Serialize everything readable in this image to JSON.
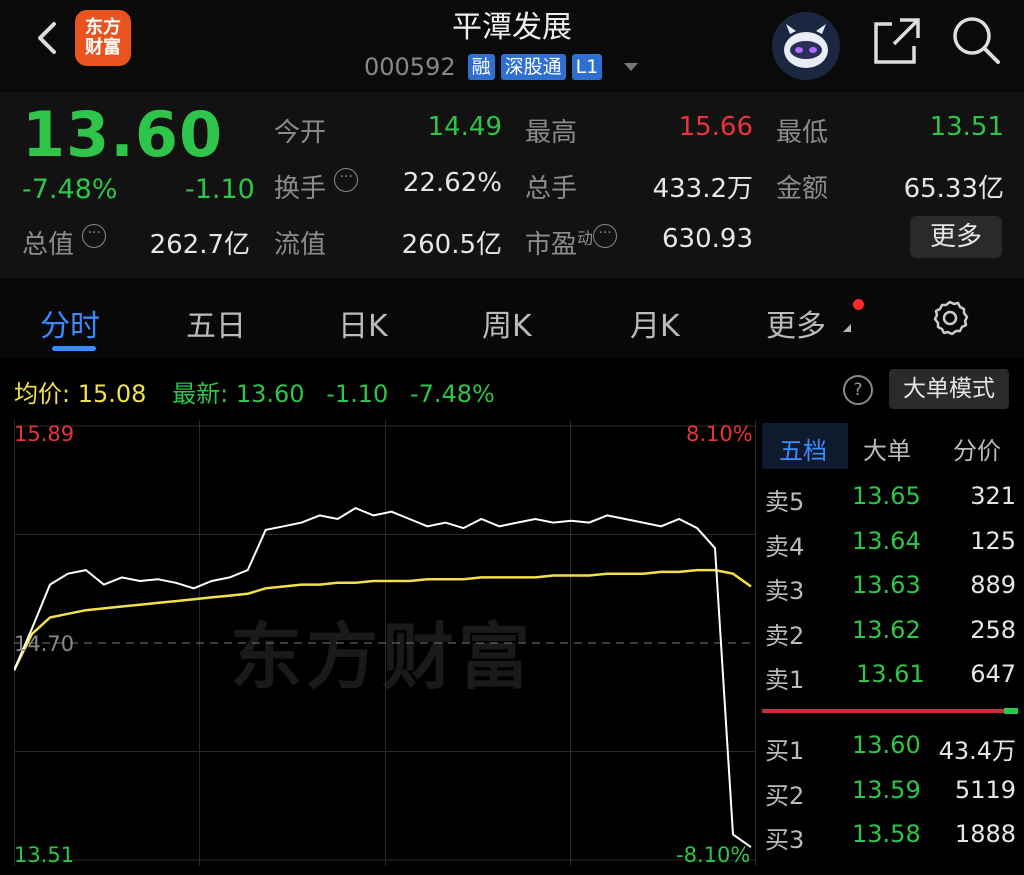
{
  "header": {
    "title": "平潭发展",
    "code": "000592",
    "tags": [
      "融",
      "深股通",
      "L1"
    ],
    "logo_text": [
      "东方",
      "财富"
    ]
  },
  "quote": {
    "price": "13.60",
    "change_pct": "-7.48%",
    "change": "-1.10",
    "fields": {
      "open_label": "今开",
      "open": "14.49",
      "high_label": "最高",
      "high": "15.66",
      "low_label": "最低",
      "low": "13.51",
      "turnover_label": "换手",
      "turnover": "22.62%",
      "volume_label": "总手",
      "volume": "433.2万",
      "amount_label": "金额",
      "amount": "65.33亿",
      "mktcap_label": "总值",
      "mktcap": "262.7亿",
      "float_label": "流值",
      "float": "260.5亿",
      "pe_label": "市盈",
      "pe_sup": "动",
      "pe": "630.93"
    },
    "more_label": "更多"
  },
  "tabs": [
    "分时",
    "五日",
    "日K",
    "周K",
    "月K",
    "更多"
  ],
  "chart_header": {
    "avg_label": "均价:",
    "avg": "15.08",
    "latest_label": "最新:",
    "latest": "13.60",
    "change": "-1.10",
    "change_pct": "-7.48%",
    "help": "?",
    "big_order_label": "大单模式"
  },
  "chart_labels": {
    "top_left": "15.89",
    "mid_left": "14.70",
    "bottom_left": "13.51",
    "top_right": "8.10%",
    "bottom_right": "-8.10%",
    "watermark": "东方财富"
  },
  "chart_data": {
    "type": "line",
    "ylim": [
      13.51,
      15.89
    ],
    "prev_close": 14.7,
    "series": [
      {
        "values": [
          14.55,
          14.78,
          15.02,
          15.08,
          15.1,
          15.02,
          15.06,
          15.04,
          15.05,
          15.03,
          15.0,
          15.04,
          15.06,
          15.1,
          15.32,
          15.34,
          15.36,
          15.4,
          15.38,
          15.44,
          15.4,
          15.42,
          15.38,
          15.34,
          15.36,
          15.33,
          15.38,
          15.34,
          15.36,
          15.38,
          15.36,
          15.37,
          15.36,
          15.4,
          15.38,
          15.36,
          15.34,
          15.38,
          15.33,
          15.22,
          13.65,
          13.58
        ]
      },
      {
        "values": [
          14.55,
          14.75,
          14.84,
          14.86,
          14.88,
          14.89,
          14.9,
          14.91,
          14.92,
          14.93,
          14.94,
          14.95,
          14.96,
          14.97,
          15.0,
          15.01,
          15.02,
          15.02,
          15.03,
          15.03,
          15.04,
          15.04,
          15.04,
          15.05,
          15.05,
          15.05,
          15.06,
          15.06,
          15.06,
          15.06,
          15.07,
          15.07,
          15.07,
          15.08,
          15.08,
          15.08,
          15.09,
          15.09,
          15.1,
          15.1,
          15.08,
          15.01
        ]
      }
    ]
  },
  "order_book": {
    "tabs": [
      "五档",
      "大单",
      "分价"
    ],
    "asks": [
      {
        "label": "卖5",
        "price": "13.65",
        "vol": "321"
      },
      {
        "label": "卖4",
        "price": "13.64",
        "vol": "125"
      },
      {
        "label": "卖3",
        "price": "13.63",
        "vol": "889"
      },
      {
        "label": "卖2",
        "price": "13.62",
        "vol": "258"
      },
      {
        "label": "卖1",
        "price": "13.61",
        "vol": "647"
      }
    ],
    "bids": [
      {
        "label": "买1",
        "price": "13.60",
        "vol": "43.4万"
      },
      {
        "label": "买2",
        "price": "13.59",
        "vol": "5119"
      },
      {
        "label": "买3",
        "price": "13.58",
        "vol": "1888"
      }
    ]
  },
  "colors": {
    "up": "#e8343a",
    "down": "#2fc44a",
    "accent": "#3a8dff",
    "price_line": "#ffffff",
    "avg_line": "#f2e04a"
  }
}
